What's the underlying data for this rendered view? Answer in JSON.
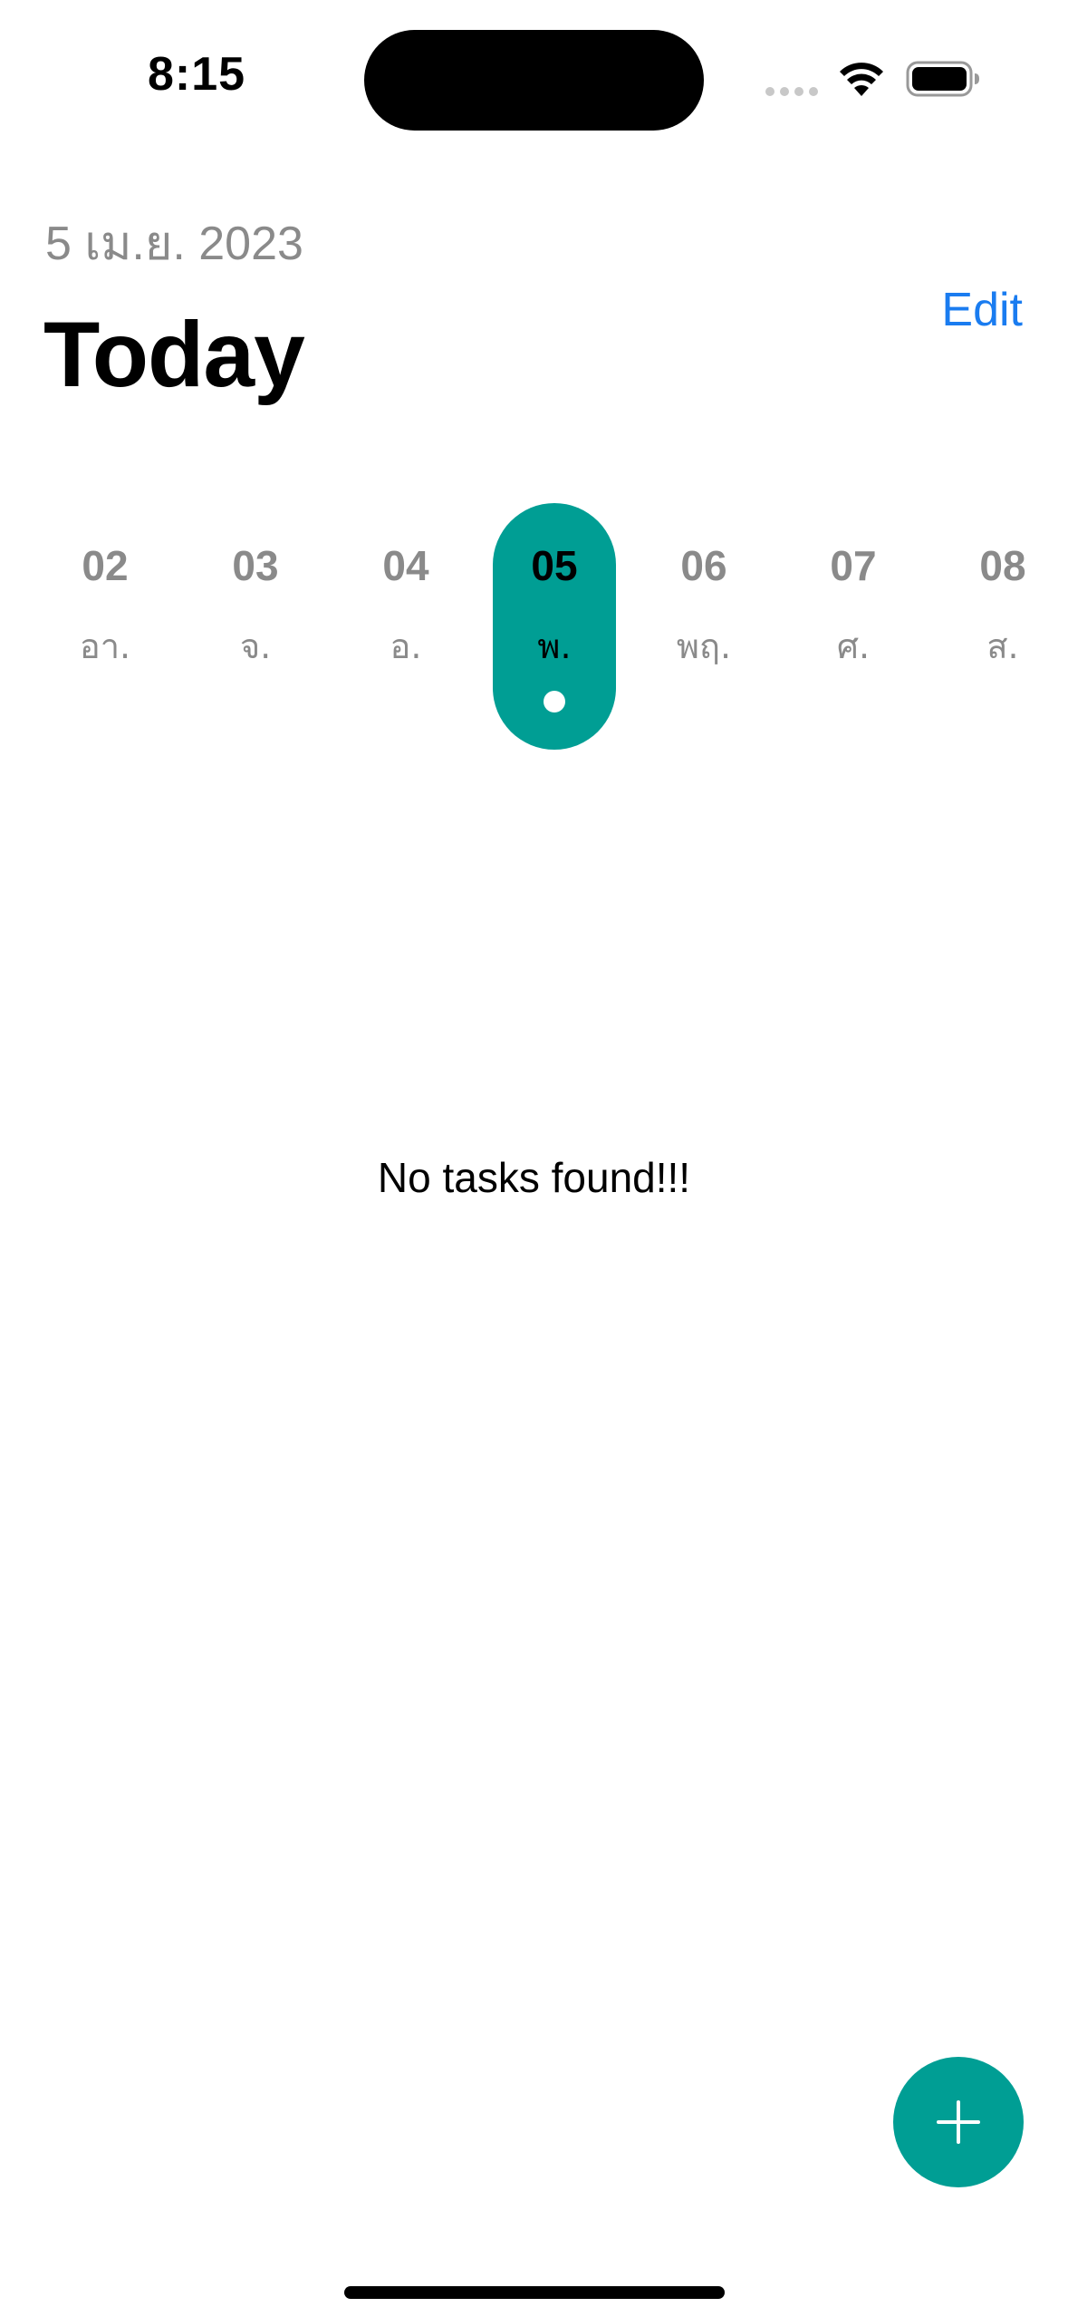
{
  "status_bar": {
    "time": "8:15",
    "icons": [
      "cellular-signal-icon",
      "wifi-icon",
      "battery-icon"
    ]
  },
  "header": {
    "date": "5 เม.ย. 2023",
    "title": "Today",
    "edit_label": "Edit"
  },
  "week": {
    "days": [
      {
        "number": "02",
        "weekday": "อา.",
        "selected": false
      },
      {
        "number": "03",
        "weekday": "จ.",
        "selected": false
      },
      {
        "number": "04",
        "weekday": "อ.",
        "selected": false
      },
      {
        "number": "05",
        "weekday": "พ.",
        "selected": true
      },
      {
        "number": "06",
        "weekday": "พฤ.",
        "selected": false
      },
      {
        "number": "07",
        "weekday": "ศ.",
        "selected": false
      },
      {
        "number": "08",
        "weekday": "ส.",
        "selected": false
      }
    ]
  },
  "tasks": {
    "empty_message": "No tasks found!!!"
  },
  "add_button": {
    "icon": "plus-icon"
  },
  "colors": {
    "accent": "#009e94",
    "link": "#1a7cf0",
    "secondary_text": "#8a8a8a"
  }
}
